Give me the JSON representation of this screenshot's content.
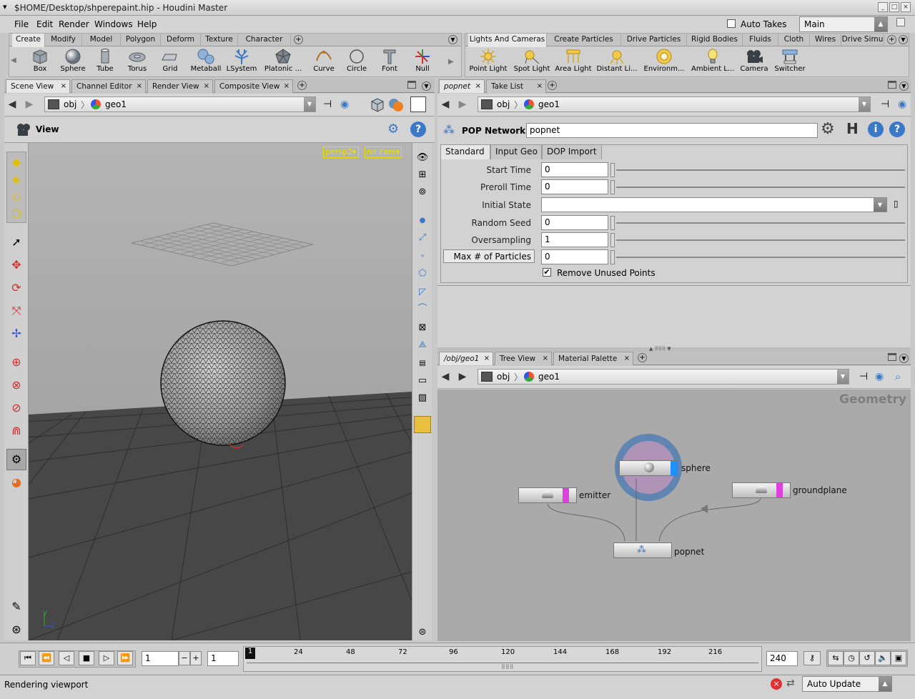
{
  "window": {
    "title": "$HOME/Desktop/shperepaint.hip - Houdini Master"
  },
  "menu": [
    "File",
    "Edit",
    "Render",
    "Windows",
    "Help"
  ],
  "auto_takes": {
    "label": "Auto Takes",
    "checked": false
  },
  "desktop": {
    "value": "Main"
  },
  "shelf_left": {
    "tabs": [
      "Create",
      "Modify",
      "Model",
      "Polygon",
      "Deform",
      "Texture",
      "Character"
    ],
    "active": "Create",
    "tools": [
      "Box",
      "Sphere",
      "Tube",
      "Torus",
      "Grid",
      "Metaball",
      "LSystem",
      "Platonic ...",
      "Curve",
      "Circle",
      "Font",
      "Null"
    ]
  },
  "shelf_right": {
    "tabs": [
      "Lights And Cameras",
      "Create Particles",
      "Drive Particles",
      "Rigid Bodies",
      "Fluids",
      "Cloth",
      "Wires",
      "Drive Simu"
    ],
    "active": "Lights And Cameras",
    "tools": [
      "Point Light",
      "Spot Light",
      "Area Light",
      "Distant Li...",
      "Environm...",
      "Ambient L...",
      "Camera",
      "Switcher"
    ]
  },
  "left_pane": {
    "tabs": [
      "Scene View",
      "Channel Editor",
      "Render View",
      "Composite View"
    ],
    "active": "Scene View",
    "path": {
      "obj": "obj",
      "geo": "geo1"
    },
    "view_label": "View",
    "camera_menu": "persp2",
    "cam_menu": "no cam",
    "axis": {
      "y": "y",
      "z": "z"
    }
  },
  "params_pane": {
    "tabs": [
      "popnet",
      "Take List"
    ],
    "active": "popnet",
    "path": {
      "obj": "obj",
      "geo": "geo1"
    },
    "node_type": "POP Network",
    "node_name": "popnet",
    "ptabs": [
      "Standard",
      "Input Geo",
      "DOP Import"
    ],
    "active_ptab": "Standard",
    "params": [
      {
        "label": "Start Time",
        "value": "0"
      },
      {
        "label": "Preroll Time",
        "value": "0"
      },
      {
        "label": "Initial State",
        "value": ""
      },
      {
        "label": "Random Seed",
        "value": "0"
      },
      {
        "label": "Oversampling",
        "value": "1"
      },
      {
        "label": "Max # of Particles",
        "value": "0"
      }
    ],
    "remove_unused": {
      "label": "Remove Unused Points",
      "checked": true
    }
  },
  "network_pane": {
    "tabs": [
      "/obj/geo1",
      "Tree View",
      "Material Palette"
    ],
    "active": "/obj/geo1",
    "path": {
      "obj": "obj",
      "geo": "geo1"
    },
    "context_label": "Geometry",
    "nodes": [
      "sphere",
      "emitter",
      "groundplane",
      "popnet"
    ]
  },
  "timeline": {
    "frame": "1",
    "step": "1",
    "ticks": [
      "1",
      "24",
      "48",
      "72",
      "96",
      "120",
      "144",
      "168",
      "192",
      "216"
    ],
    "end": "240"
  },
  "status": {
    "message": "Rendering viewport",
    "update_mode": "Auto Update"
  },
  "colors": {
    "viewport_bg": "#a8a8a8",
    "ground": "#4a4a4a",
    "handle_yellow": "#e8e000",
    "node_blue": "#1e90ff",
    "node_magenta": "#e040e0"
  }
}
